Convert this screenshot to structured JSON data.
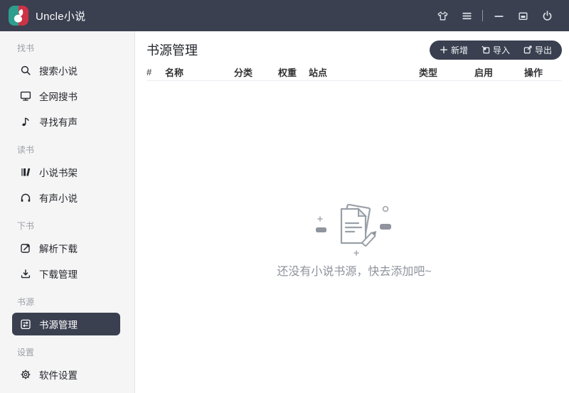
{
  "titlebar": {
    "app_title": "Uncle小说",
    "controls": [
      {
        "name": "theme",
        "icon": "tshirt-icon"
      },
      {
        "name": "menu",
        "icon": "hamburger-icon"
      },
      {
        "name": "minimize",
        "icon": "minimize-icon"
      },
      {
        "name": "maximize",
        "icon": "maximize-icon"
      },
      {
        "name": "power",
        "icon": "power-icon"
      }
    ]
  },
  "sidebar": {
    "sections": [
      {
        "label": "找书",
        "items": [
          {
            "label": "搜索小说",
            "icon": "search-icon"
          },
          {
            "label": "全网搜书",
            "icon": "monitor-icon"
          },
          {
            "label": "寻找有声",
            "icon": "music-note-icon"
          }
        ]
      },
      {
        "label": "读书",
        "items": [
          {
            "label": "小说书架",
            "icon": "bookshelf-icon"
          },
          {
            "label": "有声小说",
            "icon": "headphones-icon"
          }
        ]
      },
      {
        "label": "下书",
        "items": [
          {
            "label": "解析下载",
            "icon": "parse-icon"
          },
          {
            "label": "下载管理",
            "icon": "download-icon"
          }
        ]
      },
      {
        "label": "书源",
        "items": [
          {
            "label": "书源管理",
            "icon": "book-source-icon",
            "active": true
          }
        ]
      },
      {
        "label": "设置",
        "items": [
          {
            "label": "软件设置",
            "icon": "gear-icon"
          }
        ]
      }
    ]
  },
  "main": {
    "title": "书源管理",
    "actions": [
      {
        "label": "新增",
        "icon": "plus-icon"
      },
      {
        "label": "导入",
        "icon": "import-icon"
      },
      {
        "label": "导出",
        "icon": "export-icon"
      }
    ],
    "table": {
      "columns": [
        "#",
        "名称",
        "分类",
        "权重",
        "站点",
        "类型",
        "启用",
        "操作"
      ]
    },
    "empty": {
      "text": "还没有小说书源，快去添加吧~"
    }
  },
  "colors": {
    "topbar": "#3a4050",
    "logo_green": "#2e9e8f",
    "logo_red": "#cd3246",
    "sidebar_bg": "#f5f5f6",
    "active_item_bg": "#3a4050",
    "header_border": "#ebedf2",
    "empty_text": "#8e939c"
  }
}
